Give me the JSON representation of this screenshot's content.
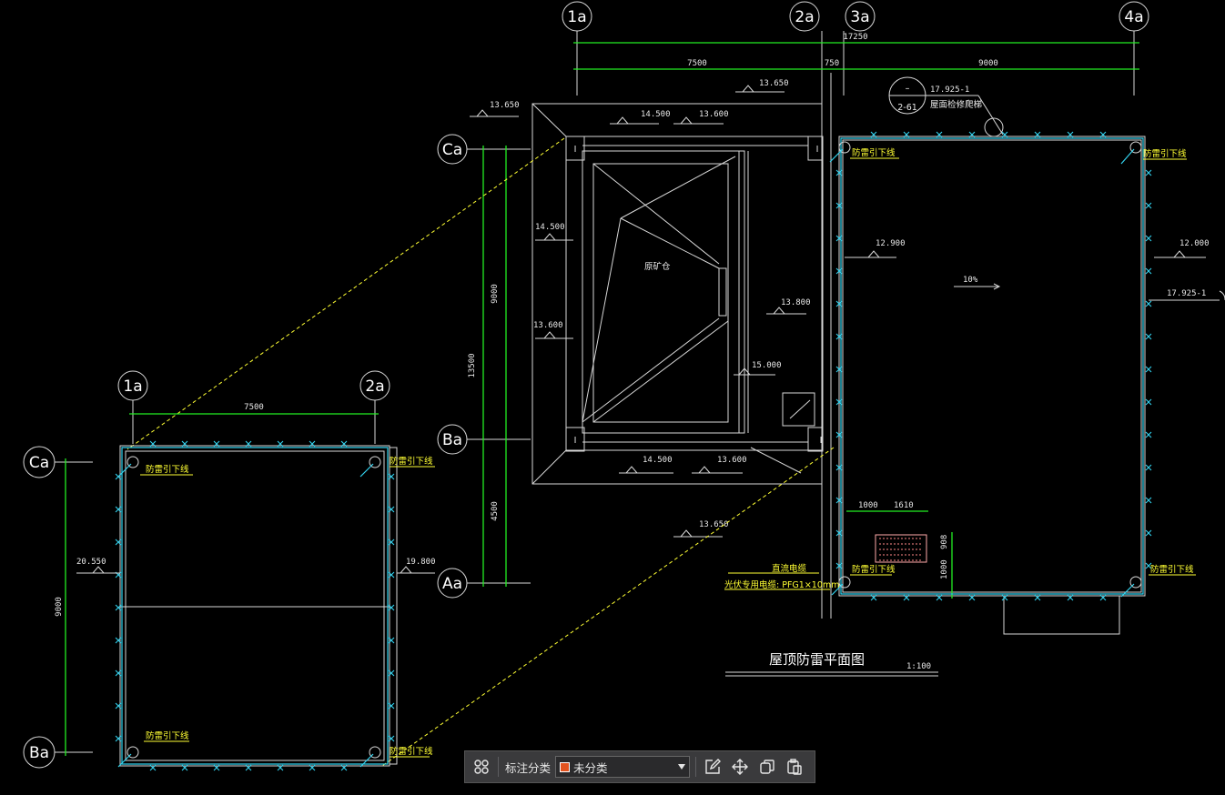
{
  "colors": {
    "background": "#000000",
    "lines": "#d8d8d8",
    "dimension": "#22ee22",
    "roof_edge": "#33d4f0",
    "annotation": "#ffff33",
    "toolbar": "#3a3a3c",
    "category_swatch": "#e2531f"
  },
  "drawing": {
    "axis_labels": {
      "a1": "1a",
      "a2": "2a",
      "a3": "3a",
      "a4": "4a",
      "ca": "Ca",
      "ba": "Ba",
      "aa": "Aa"
    },
    "dims": {
      "total_top": "17250",
      "span_1_2": "7500",
      "span_2_3": "750",
      "span_3_4": "9000",
      "left_9000": "9000",
      "left_13500": "13500",
      "left_4500": "4500",
      "detail_7500": "7500",
      "detail_9000": "9000",
      "dim_1000a": "1000",
      "dim_1610": "1610",
      "dim_908": "908",
      "dim_1000b": "1000"
    },
    "elevations": {
      "e1": "13.650",
      "e2": "13.650",
      "e3": "14.500",
      "e4": "13.600",
      "e5": "14.500",
      "e6": "13.600",
      "e7": "13.800",
      "e8": "15.000",
      "e9": "14.500",
      "e10": "13.600",
      "e11": "13.650",
      "e12": "12.900",
      "e13": "12.000",
      "e14": "17.925-1",
      "e15": "20.550",
      "e16": "19.800",
      "e17": "17.925-1"
    },
    "annotations": {
      "lightning_down": "防雷引下线",
      "raw_bin": "原矿仓",
      "slope": "10%",
      "detail_ref_top": "–",
      "detail_ref_bottom": "2-61",
      "roof_access": "屋面检修爬梯",
      "dc_cable": "直流电缆",
      "pv_cable": "光伏专用电缆: PFG1×10mm",
      "title": "屋顶防雷平面图",
      "scale": "1:100"
    }
  },
  "toolbar": {
    "grid_icon": "grid-icon",
    "label": "标注分类",
    "category_value": "未分类",
    "edit_icon": "edit-icon",
    "move_icon": "move-icon",
    "copy_icon": "copy-icon",
    "paste_icon": "paste-icon"
  }
}
